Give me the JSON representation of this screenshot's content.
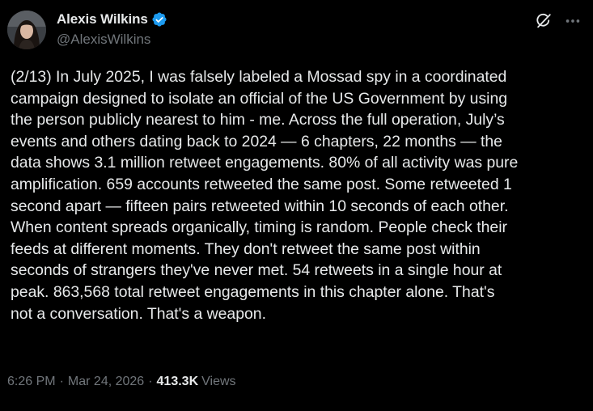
{
  "author": {
    "display_name": "Alexis Wilkins",
    "handle": "@AlexisWilkins",
    "verified": true,
    "verified_color": "#1d9bf0"
  },
  "post": {
    "lines": [
      "(2/13) In July 2025, I was falsely labeled a Mossad spy in a coordinated",
      "campaign designed to isolate an official of the US Government by using",
      "the person publicly nearest to him - me. Across the full operation, July’s",
      "events and others dating back to 2024 — 6 chapters, 22 months — the",
      "data shows 3.1 million retweet engagements. 80% of all activity was pure",
      "amplification. 659 accounts retweeted the same post. Some retweeted 1",
      "second apart — fifteen pairs retweeted within 10 seconds of each other.",
      "When content spreads organically, timing is random. People check their",
      "feeds at different moments. They don't retweet the same post within",
      "seconds of strangers they've never met. 54 retweets in a single hour at",
      "peak. 863,568 total retweet engagements in this chapter alone. That's",
      "not a conversation. That's a weapon."
    ]
  },
  "meta": {
    "time": "6:26 PM",
    "separator": "·",
    "date": "Mar 24, 2026",
    "views_count": "413.3K",
    "views_label": "Views"
  },
  "icons": {
    "grok": "grok-icon",
    "more": "more-icon",
    "verified": "verified-badge-icon"
  },
  "colors": {
    "background": "#000000",
    "text_primary": "#e7e9ea",
    "text_secondary": "#71767b"
  }
}
